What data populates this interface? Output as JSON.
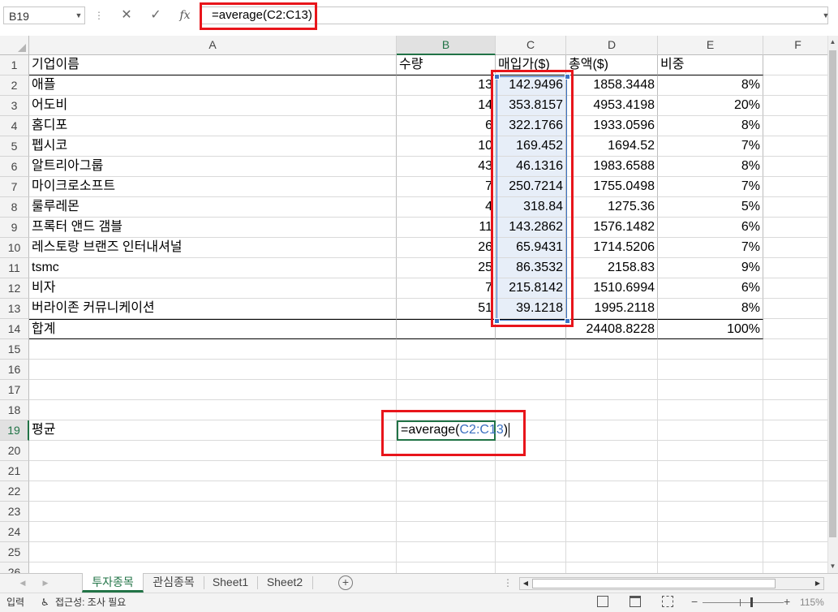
{
  "formula_bar": {
    "name_box": "B19",
    "cancel_icon": "✕",
    "enter_icon": "✓",
    "fx_label": "fx",
    "formula": "=average(C2:C13)"
  },
  "columns": [
    "A",
    "B",
    "C",
    "D",
    "E",
    "F"
  ],
  "rows": [
    "1",
    "2",
    "3",
    "4",
    "5",
    "6",
    "7",
    "8",
    "9",
    "10",
    "11",
    "12",
    "13",
    "14",
    "15",
    "16",
    "17",
    "18",
    "19",
    "20",
    "21",
    "22",
    "23",
    "24",
    "25",
    "26"
  ],
  "table": {
    "headers": [
      "기업이름",
      "수량",
      "매입가($)",
      "총액($)",
      "비중"
    ],
    "rows": [
      [
        "애플",
        "13",
        "142.9496",
        "1858.3448",
        "8%"
      ],
      [
        "어도비",
        "14",
        "353.8157",
        "4953.4198",
        "20%"
      ],
      [
        "홈디포",
        "6",
        "322.1766",
        "1933.0596",
        "8%"
      ],
      [
        "펩시코",
        "10",
        "169.452",
        "1694.52",
        "7%"
      ],
      [
        "알트리아그룹",
        "43",
        "46.1316",
        "1983.6588",
        "8%"
      ],
      [
        "마이크로소프트",
        "7",
        "250.7214",
        "1755.0498",
        "7%"
      ],
      [
        "룰루레몬",
        "4",
        "318.84",
        "1275.36",
        "5%"
      ],
      [
        "프록터 앤드 갬블",
        "11",
        "143.2862",
        "1576.1482",
        "6%"
      ],
      [
        "레스토랑 브랜즈 인터내셔널",
        "26",
        "65.9431",
        "1714.5206",
        "7%"
      ],
      [
        "tsmc",
        "25",
        "86.3532",
        "2158.83",
        "9%"
      ],
      [
        "비자",
        "7",
        "215.8142",
        "1510.6994",
        "6%"
      ],
      [
        "버라이존 커뮤니케이션",
        "51",
        "39.1218",
        "1995.2118",
        "8%"
      ]
    ],
    "total": [
      "합계",
      "",
      "",
      "24408.8228",
      "100%"
    ]
  },
  "average": {
    "label": "평균",
    "formula_prefix": "=average(",
    "formula_ref": "C2:C13",
    "formula_suffix": ")"
  },
  "sheets": {
    "tabs": [
      "투자종목",
      "관심종목",
      "Sheet1",
      "Sheet2"
    ],
    "active": "투자종목",
    "add_label": "+"
  },
  "status_bar": {
    "mode": "입력",
    "accessibility": "접근성: 조사 필요",
    "zoom": "115%"
  },
  "colors": {
    "accent": "#217346",
    "selection": "#3b73c4",
    "highlight": "#e8151b"
  }
}
